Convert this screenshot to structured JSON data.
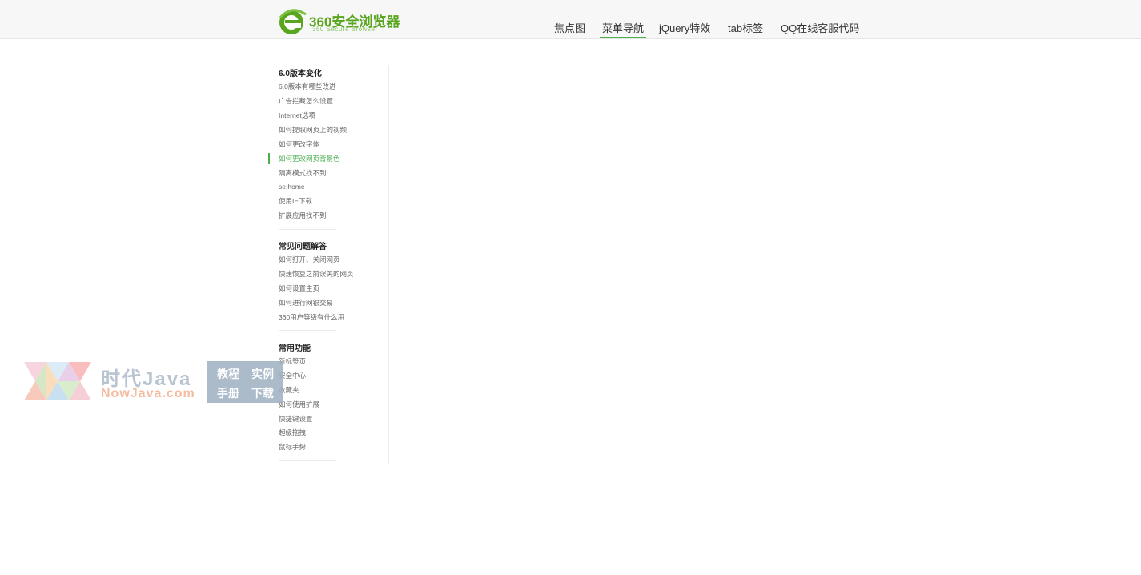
{
  "header": {
    "logo_text": "360安全浏览器",
    "logo_subtext": "360 Secure Browser",
    "nav": [
      "焦点图",
      "菜单导航",
      "jQuery特效",
      "tab标签",
      "QQ在线客服代码"
    ],
    "active_nav": "菜单导航"
  },
  "sidebar": {
    "groups": [
      {
        "title": "6.0版本变化",
        "items": [
          "6.0版本有哪些改进",
          "广告拦截怎么设置",
          "Internet选项",
          "如何提取网页上的视频",
          "如何更改字体",
          "如何更改网页背景色",
          "隔离模式找不到",
          "se:home",
          "使用IE下载",
          "扩展应用找不到"
        ]
      },
      {
        "title": "常见问题解答",
        "items": [
          "如何打开、关闭网页",
          "快速恢复之前误关的网页",
          "如何设置主页",
          "如何进行网银交易",
          "360用户等级有什么用"
        ]
      },
      {
        "title": "常用功能",
        "items": [
          "新标签页",
          "安全中心",
          "收藏夹",
          "如何使用扩展",
          "快捷键设置",
          "超级拖拽",
          "鼠标手势"
        ]
      }
    ],
    "active_item": "如何更改网页背景色"
  },
  "watermark": {
    "title": "时代Java",
    "url": "NowJava.com",
    "cells": [
      "教程",
      "实例",
      "手册",
      "下载"
    ]
  },
  "colors": {
    "accent": "#4caf50",
    "logo": "#5aa51f",
    "header_bg": "#f7f7f7"
  }
}
